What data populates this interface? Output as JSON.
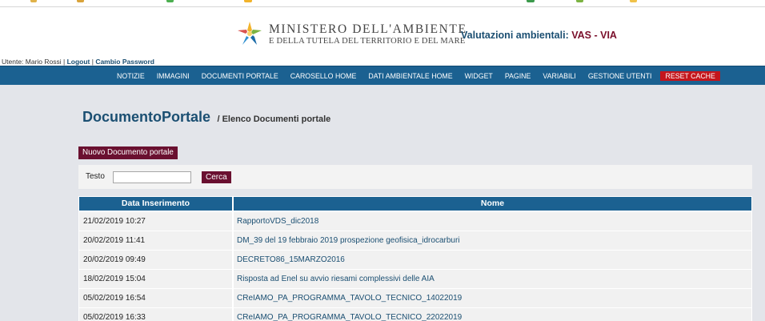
{
  "header": {
    "ministry_line1": "MINISTERO DELL'AMBIENTE",
    "ministry_line2": "E DELLA TUTELA DEL TERRITORIO E DEL MARE",
    "site_title_prefix": "Valutazioni ambientali:",
    "site_title_accent": "VAS - VIA"
  },
  "userbar": {
    "user_text": "Utente: Mario Rossi",
    "logout": "Logout",
    "change_password": "Cambio Password"
  },
  "nav": {
    "items": [
      "NOTIZIE",
      "IMMAGINI",
      "DOCUMENTI PORTALE",
      "CAROSELLO HOME",
      "DATI AMBIENTALE HOME",
      "WIDGET",
      "PAGINE",
      "VARIABILI",
      "GESTIONE UTENTI"
    ],
    "reset": "RESET CACHE"
  },
  "page": {
    "title": "DocumentoPortale",
    "subtitle": "/ Elenco Documenti portale",
    "new_button": "Nuovo Documento portale"
  },
  "search": {
    "label": "Testo",
    "value": "",
    "placeholder": "",
    "button": "Cerca"
  },
  "table": {
    "headers": [
      "Data Inserimento",
      "Nome"
    ],
    "rows": [
      {
        "date": "21/02/2019 10:27",
        "name": "RapportoVDS_dic2018"
      },
      {
        "date": "20/02/2019 11:41",
        "name": "DM_39 del 19 febbraio 2019 prospezione geofisica_idrocarburi"
      },
      {
        "date": "20/02/2019 09:49",
        "name": "DECRETO86_15MARZO2016"
      },
      {
        "date": "18/02/2019 15:04",
        "name": "Risposta ad Enel su avvio riesami complessivi delle AIA"
      },
      {
        "date": "05/02/2019 16:54",
        "name": "CReIAMO_PA_PROGRAMMA_TAVOLO_TECNICO_14022019"
      },
      {
        "date": "05/02/2019 16:33",
        "name": "CReIAMO_PA_PROGRAMMA_TAVOLO_TECNICO_22022019"
      }
    ]
  },
  "colors": {
    "primary_blue": "#1b6191",
    "title_blue": "#1b4f72",
    "maroon_button": "#6a1030",
    "reset_red": "#c4161c",
    "background": "#e3e5ea"
  }
}
